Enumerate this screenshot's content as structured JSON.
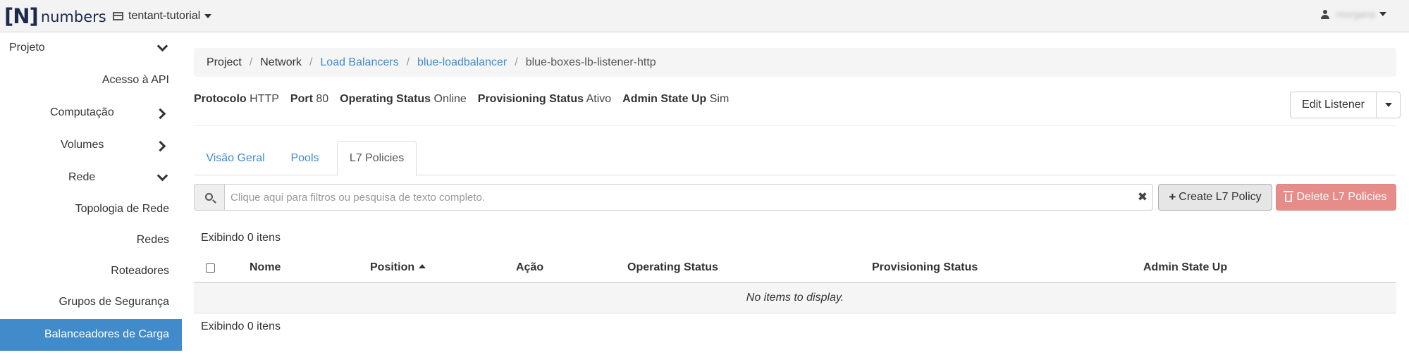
{
  "header": {
    "brand_bracket_open": "[",
    "brand_letter": "N",
    "brand_bracket_close": "]",
    "brand_word": "numbers",
    "project_name": "tentant-tutorial",
    "user_name": "morgana"
  },
  "sidebar": {
    "items": [
      {
        "label": "Projeto",
        "indicator": "chevron-down"
      },
      {
        "label": "Acesso à API"
      },
      {
        "label": "Computação",
        "indicator": "chevron-right"
      },
      {
        "label": "Volumes",
        "indicator": "chevron-right"
      },
      {
        "label": "Rede",
        "indicator": "chevron-down"
      },
      {
        "label": "Topologia de Rede"
      },
      {
        "label": "Redes"
      },
      {
        "label": "Roteadores"
      },
      {
        "label": "Grupos de Segurança"
      },
      {
        "label": "Balanceadores de Carga",
        "active": true
      }
    ]
  },
  "breadcrumb": {
    "items": [
      "Project",
      "Network",
      "Load Balancers",
      "blue-loadbalancer",
      "blue-boxes-lb-listener-http"
    ],
    "separator": "/"
  },
  "details": {
    "protocol_label": "Protocolo",
    "protocol_value": "HTTP",
    "port_label": "Port",
    "port_value": "80",
    "operating_label": "Operating Status",
    "operating_value": "Online",
    "provisioning_label": "Provisioning Status",
    "provisioning_value": "Ativo",
    "admin_label": "Admin State Up",
    "admin_value": "Sim"
  },
  "actions": {
    "edit_label": "Edit Listener"
  },
  "tabs": [
    "Visão Geral",
    "Pools",
    "L7 Policies"
  ],
  "active_tab": "L7 Policies",
  "search": {
    "placeholder": "Clique aqui para filtros ou pesquisa de texto completo.",
    "value": "",
    "clear_glyph": "✖"
  },
  "table_actions": {
    "create_label": "Create L7 Policy",
    "delete_label": "Delete L7 Policies"
  },
  "table": {
    "count_text": "Exibindo 0 itens",
    "columns": [
      "Nome",
      "Position",
      "Ação",
      "Operating Status",
      "Provisioning Status",
      "Admin State Up"
    ],
    "sorted_column": "Position",
    "sort_direction": "asc",
    "empty_message": "No items to display."
  },
  "colors": {
    "accent": "#428bca",
    "danger_button": "#e58784",
    "topbar": "#f3f3f3"
  }
}
